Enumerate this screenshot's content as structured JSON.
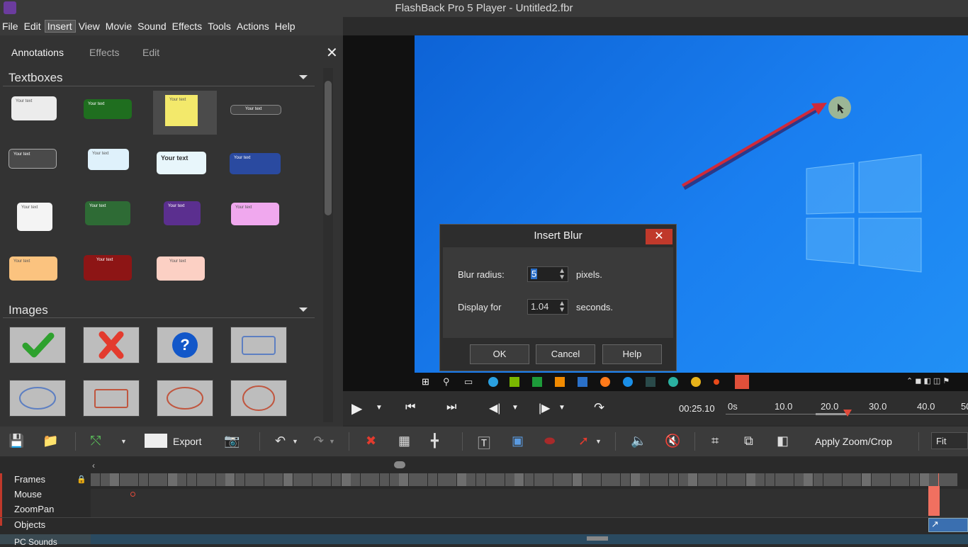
{
  "window": {
    "title": "FlashBack Pro 5 Player - Untitled2.fbr"
  },
  "menu": [
    "File",
    "Edit",
    "Insert",
    "View",
    "Movie",
    "Sound",
    "Effects",
    "Tools",
    "Actions",
    "Help"
  ],
  "panel": {
    "tabs": [
      "Annotations",
      "Effects",
      "Edit"
    ],
    "active_tab": "Annotations",
    "close_glyph": "✕",
    "sections": {
      "textboxes": "Textboxes",
      "images": "Images"
    },
    "textbox_sample": "Your text"
  },
  "dialog": {
    "title": "Insert Blur",
    "close_glyph": "✕",
    "blur_label": "Blur radius:",
    "blur_value": "5",
    "blur_unit": "pixels.",
    "display_label": "Display for",
    "display_value": "1.04",
    "display_unit": "seconds.",
    "ok": "OK",
    "cancel": "Cancel",
    "help": "Help"
  },
  "transport": {
    "time": "00:25.10",
    "ruler": [
      "0s",
      "10.0",
      "20.0",
      "30.0",
      "40.0",
      "50"
    ]
  },
  "toolbar": {
    "export": "Export",
    "apply_zoom": "Apply Zoom/Crop",
    "fit": "Fit"
  },
  "timeline": {
    "rows": [
      "Frames",
      "Mouse",
      "ZoomPan",
      "Objects",
      "PC Sounds"
    ]
  },
  "colors": {
    "accent_red": "#c0392b",
    "playhead": "#f07060",
    "desktop_blue": "#1576e8"
  }
}
